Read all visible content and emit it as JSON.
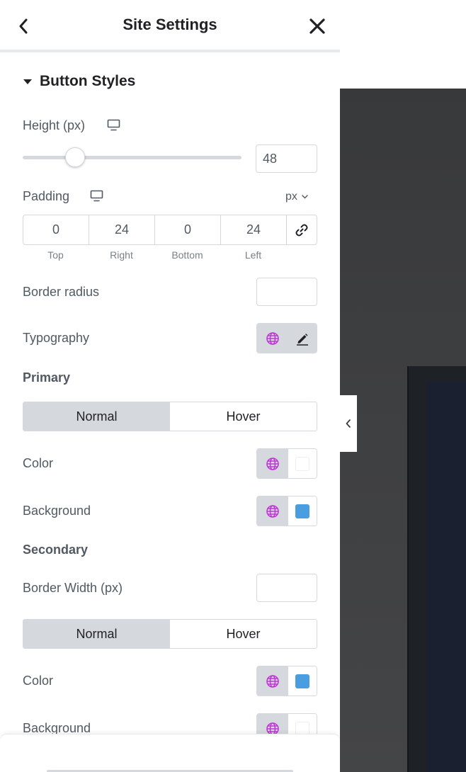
{
  "header": {
    "title": "Site Settings"
  },
  "section": {
    "title": "Button Styles"
  },
  "height": {
    "label": "Height (px)",
    "value": "48",
    "slider_fraction": 0.24
  },
  "padding": {
    "label": "Padding",
    "unit": "px",
    "values": {
      "top": "0",
      "right": "24",
      "bottom": "0",
      "left": "24"
    },
    "labels": {
      "top": "Top",
      "right": "Right",
      "bottom": "Bottom",
      "left": "Left"
    }
  },
  "border_radius": {
    "label": "Border radius",
    "value": ""
  },
  "typography": {
    "label": "Typography"
  },
  "primary": {
    "title": "Primary",
    "tabs": {
      "normal": "Normal",
      "hover": "Hover"
    },
    "color": {
      "label": "Color",
      "swatch": "#ffffff"
    },
    "background": {
      "label": "Background",
      "swatch": "#4a9de0"
    }
  },
  "secondary": {
    "title": "Secondary",
    "border_width": {
      "label": "Border Width (px)",
      "value": ""
    },
    "tabs": {
      "normal": "Normal",
      "hover": "Hover"
    },
    "color": {
      "label": "Color",
      "swatch": "#4a9de0"
    },
    "background": {
      "label": "Background",
      "swatch": "#ffffff"
    }
  },
  "colors": {
    "accent_globe": "#c036d6",
    "panel_bg": "#ffffff",
    "control_bg": "#d5d8dc"
  },
  "icons": [
    "back-chevron-icon",
    "close-icon",
    "caret-down-icon",
    "desktop-icon",
    "link-icon",
    "globe-icon",
    "pencil-icon",
    "collapse-chevron-icon"
  ]
}
